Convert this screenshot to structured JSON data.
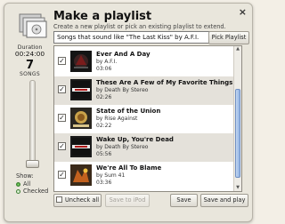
{
  "dialog": {
    "title": "Make a playlist",
    "subtitle": "Create a new playlist or pick an existing playlist to extend.",
    "search_value": "Songs that sound like \"The Last Kiss\" by A.F.I.",
    "pick_playlist_label": "Pick Playlist",
    "close_label": "×"
  },
  "sidebar": {
    "duration_label": "Duration",
    "duration_value": "00:24:00",
    "songs_count": "7",
    "songs_label": "SONGS",
    "show_label": "Show:",
    "filter_options": [
      {
        "label": "All",
        "selected": true
      },
      {
        "label": "Checked",
        "selected": false
      }
    ]
  },
  "songs": [
    {
      "title": "Ever And A Day",
      "artist": "by A.F.I.",
      "duration": "03:06",
      "checked": true,
      "art_text": ""
    },
    {
      "title": "These Are A Few of My Favorite Things",
      "artist": "by Death By Stereo",
      "duration": "02:26",
      "checked": true,
      "art_text": "DEATH STEREO"
    },
    {
      "title": "State of the Union",
      "artist": "by Rise Against",
      "duration": "02:22",
      "checked": true,
      "art_text": ""
    },
    {
      "title": "Wake Up, You're Dead",
      "artist": "by Death By Stereo",
      "duration": "05:56",
      "checked": true,
      "art_text": "DEATH STEREO"
    },
    {
      "title": "We're All To Blame",
      "artist": "by Sum 41",
      "duration": "03:36",
      "checked": true,
      "art_text": ""
    }
  ],
  "footer": {
    "uncheck_all_label": "Uncheck all",
    "save_to_ipod_label": "Save to iPod",
    "save_label": "Save",
    "save_and_play_label": "Save and play"
  },
  "colors": {
    "accent_green": "#2d8a1e",
    "scroll_blue": "#8fb1e3",
    "window_bg": "#e9e6dc"
  }
}
